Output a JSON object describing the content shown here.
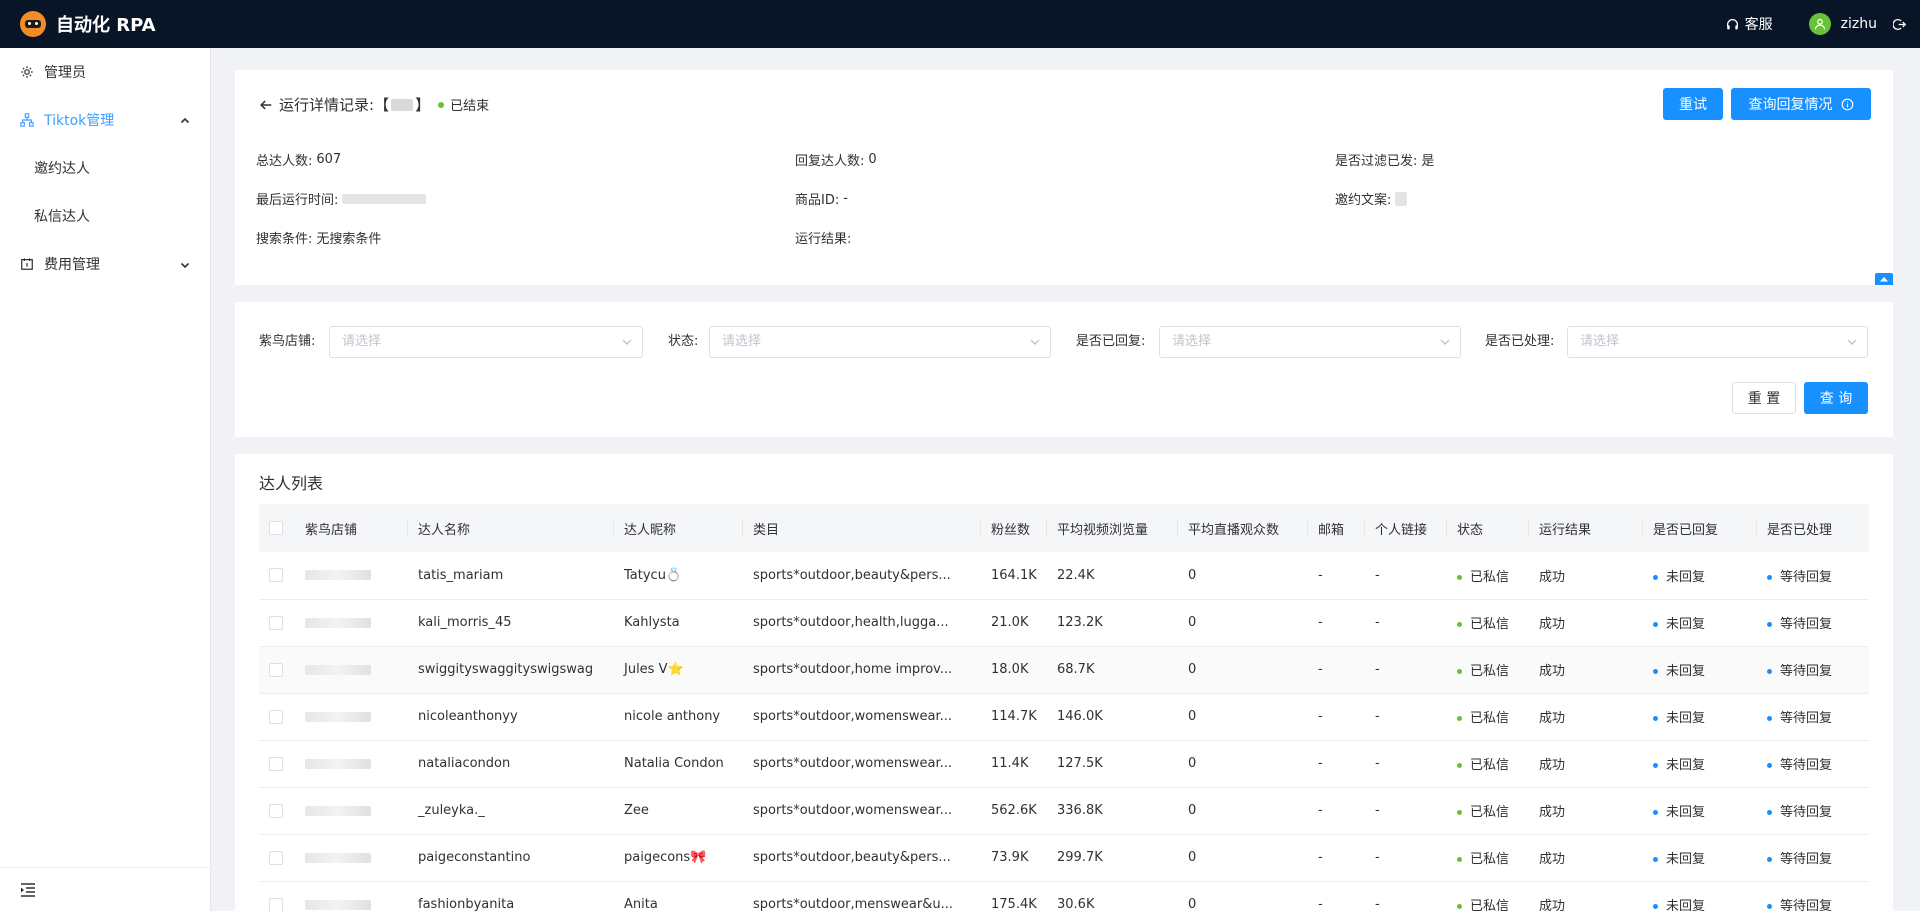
{
  "app": {
    "title": "自动化 RPA"
  },
  "header": {
    "service_label": "客服",
    "username": "zizhu"
  },
  "sidebar": {
    "items": [
      {
        "label": "管理员",
        "icon": "gear-icon"
      },
      {
        "label": "Tiktok管理",
        "icon": "sitemap-icon",
        "expanded": true,
        "children": [
          {
            "label": "邀约达人"
          },
          {
            "label": "私信达人"
          }
        ]
      },
      {
        "label": "费用管理",
        "icon": "calendar-icon",
        "expanded": false
      }
    ]
  },
  "detail": {
    "title": "运行详情记录:",
    "bracket_open": "【",
    "bracket_close": "】",
    "status": "已结束",
    "status_color": "#67c23a",
    "retry_label": "重试",
    "query_reply_label": "查询回复情况",
    "info": {
      "total_label": "总达人数:",
      "total_value": "607",
      "reply_label": "回复达人数:",
      "reply_value": "0",
      "filtered_label": "是否过滤已发:",
      "filtered_value": "是",
      "last_run_label": "最后运行时间:",
      "product_label": "商品ID:",
      "product_value": "-",
      "invite_text_label": "邀约文案:",
      "search_label": "搜索条件:",
      "search_value": "无搜索条件",
      "result_label": "运行结果:"
    }
  },
  "filters": {
    "shop_label": "紫鸟店铺:",
    "status_label": "状态:",
    "replied_label": "是否已回复:",
    "processed_label": "是否已处理:",
    "placeholder": "请选择",
    "reset_label": "重 置",
    "search_label": "查 询"
  },
  "list": {
    "title": "达人列表",
    "columns": [
      "紫鸟店铺",
      "达人名称",
      "达人昵称",
      "类目",
      "粉丝数",
      "平均视频浏览量",
      "平均直播观众数",
      "邮箱",
      "个人链接",
      "状态",
      "运行结果",
      "是否已回复",
      "是否已处理"
    ],
    "rows": [
      {
        "name": "tatis_mariam",
        "nickname": "Tatycu💍",
        "category": "sports*outdoor,beauty&pers...",
        "fans": "164.1K",
        "avg_views": "22.4K",
        "avg_live": "0",
        "email": "-",
        "link": "-",
        "status": "已私信",
        "result": "成功",
        "replied": "未回复",
        "processed": "等待回复"
      },
      {
        "name": "kali_morris_45",
        "nickname": "Kahlysta",
        "category": "sports*outdoor,health,lugga...",
        "fans": "21.0K",
        "avg_views": "123.2K",
        "avg_live": "0",
        "email": "-",
        "link": "-",
        "status": "已私信",
        "result": "成功",
        "replied": "未回复",
        "processed": "等待回复"
      },
      {
        "name": "swiggityswaggityswigswag",
        "nickname": "Jules V⭐",
        "category": "sports*outdoor,home improv...",
        "fans": "18.0K",
        "avg_views": "68.7K",
        "avg_live": "0",
        "email": "-",
        "link": "-",
        "status": "已私信",
        "result": "成功",
        "replied": "未回复",
        "processed": "等待回复"
      },
      {
        "name": "nicoleanthonyy",
        "nickname": "nicole anthony",
        "category": "sports*outdoor,womenswear...",
        "fans": "114.7K",
        "avg_views": "146.0K",
        "avg_live": "0",
        "email": "-",
        "link": "-",
        "status": "已私信",
        "result": "成功",
        "replied": "未回复",
        "processed": "等待回复"
      },
      {
        "name": "nataliacondon",
        "nickname": "Natalia Condon",
        "category": "sports*outdoor,womenswear...",
        "fans": "11.4K",
        "avg_views": "127.5K",
        "avg_live": "0",
        "email": "-",
        "link": "-",
        "status": "已私信",
        "result": "成功",
        "replied": "未回复",
        "processed": "等待回复"
      },
      {
        "name": "_zuleyka._",
        "nickname": "Zee",
        "category": "sports*outdoor,womenswear...",
        "fans": "562.6K",
        "avg_views": "336.8K",
        "avg_live": "0",
        "email": "-",
        "link": "-",
        "status": "已私信",
        "result": "成功",
        "replied": "未回复",
        "processed": "等待回复"
      },
      {
        "name": "paigeconstantino",
        "nickname": "paigecons🎀",
        "category": "sports*outdoor,beauty&pers...",
        "fans": "73.9K",
        "avg_views": "299.7K",
        "avg_live": "0",
        "email": "-",
        "link": "-",
        "status": "已私信",
        "result": "成功",
        "replied": "未回复",
        "processed": "等待回复"
      },
      {
        "name": "fashionbyanita",
        "nickname": "Anita",
        "category": "sports*outdoor,menswear&u...",
        "fans": "175.4K",
        "avg_views": "30.6K",
        "avg_live": "0",
        "email": "-",
        "link": "-",
        "status": "已私信",
        "result": "成功",
        "replied": "未回复",
        "processed": "等待回复"
      }
    ]
  },
  "colors": {
    "primary": "#1890ff",
    "topbar": "#071527",
    "success_dot": "#67c23a",
    "reply_dot": "#1890ff"
  }
}
